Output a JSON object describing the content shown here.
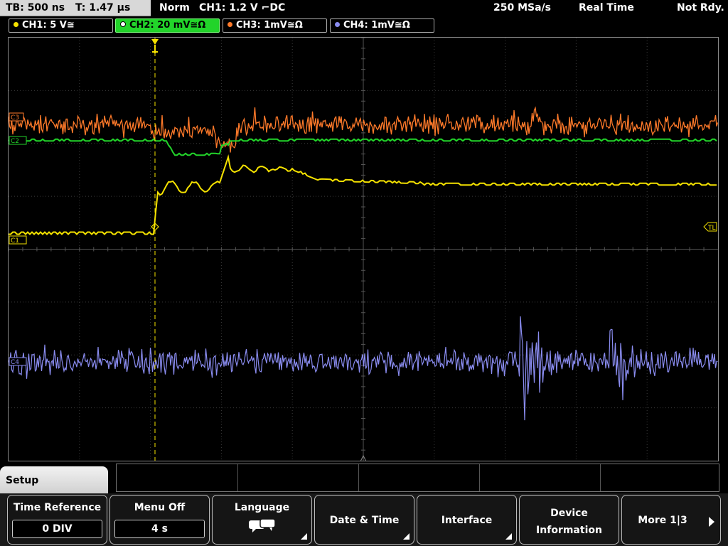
{
  "topbar": {
    "timebase": "TB: 500 ns",
    "trigger_time": "T: 1.47 µs",
    "trigger_mode": "Norm",
    "trigger_info": "CH1: 1.2 V ⌐DC",
    "sample_rate": "250 MSa/s",
    "acq_mode": "Real Time",
    "acq_state": "Not Rdy."
  },
  "channels": [
    {
      "label": "CH1: 5 V≅",
      "color": "#f5e200",
      "active": false
    },
    {
      "label": "CH2: 20 mV≅Ω",
      "color": "#22d42a",
      "active": true
    },
    {
      "label": "CH3: 1mV≅Ω",
      "color": "#ff7a2a",
      "active": false
    },
    {
      "label": "CH4: 1mV≅Ω",
      "color": "#8a8cf0",
      "active": false
    }
  ],
  "markers": {
    "c1": "C1",
    "c2": "C2",
    "c3": "C3",
    "c4": "C4",
    "trigger_level": "TL"
  },
  "colors": {
    "ch1": "#f5e200",
    "ch2": "#22d42a",
    "ch3": "#ff7a2a",
    "ch4": "#8a8cf0",
    "grid": "#3a3a3a"
  },
  "menu": {
    "title": "Setup",
    "softkeys": [
      {
        "label": "Time Reference",
        "value": "0 DIV"
      },
      {
        "label": "Menu Off",
        "value": "4 s"
      },
      {
        "label": "Language",
        "icon": "speech-bubbles-icon"
      },
      {
        "label": "Date & Time"
      },
      {
        "label": "Interface"
      },
      {
        "label_line1": "Device",
        "label_line2": "Information"
      },
      {
        "label": "More 1|3"
      }
    ]
  }
}
